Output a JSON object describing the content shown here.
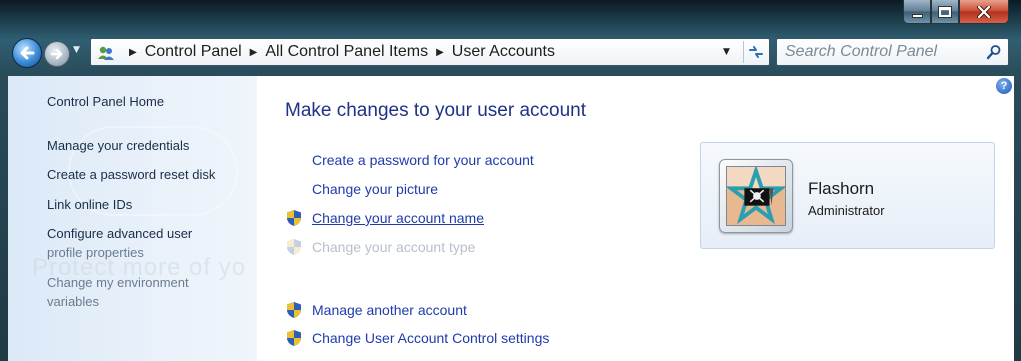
{
  "window": {
    "caption_buttons": [
      "minimize",
      "maximize",
      "close"
    ]
  },
  "navigation": {
    "back_icon": "back-arrow-icon",
    "forward_icon": "forward-arrow-icon",
    "breadcrumb": [
      "Control Panel",
      "All Control Panel Items",
      "User Accounts"
    ],
    "search_placeholder": "Search Control Panel"
  },
  "sidebar": {
    "items": [
      {
        "label": "Control Panel Home"
      },
      {
        "label": "Manage your credentials"
      },
      {
        "label": "Create a password reset disk"
      },
      {
        "label": "Link online IDs"
      },
      {
        "label": "Configure advanced user"
      },
      {
        "label": "profile properties"
      },
      {
        "label": "Change my environment"
      },
      {
        "label": "variables"
      }
    ],
    "watermark": "Protect more of yo"
  },
  "main": {
    "title": "Make changes to your user account",
    "tasks": [
      {
        "label": "Create a password for your account",
        "shield": false
      },
      {
        "label": "Change your picture",
        "shield": false
      },
      {
        "label": "Change your account name",
        "shield": true
      },
      {
        "label": "Change your account type",
        "shield": true
      },
      {
        "label": "Manage another account",
        "shield": true
      },
      {
        "label": "Change User Account Control settings",
        "shield": true
      }
    ]
  },
  "account": {
    "name": "Flashorn",
    "role": "Administrator"
  },
  "colors": {
    "link": "#1f3bab",
    "title": "#1e3287",
    "disabled": "#b7bfcb",
    "sidebar_bg": "#dbe9f7"
  }
}
